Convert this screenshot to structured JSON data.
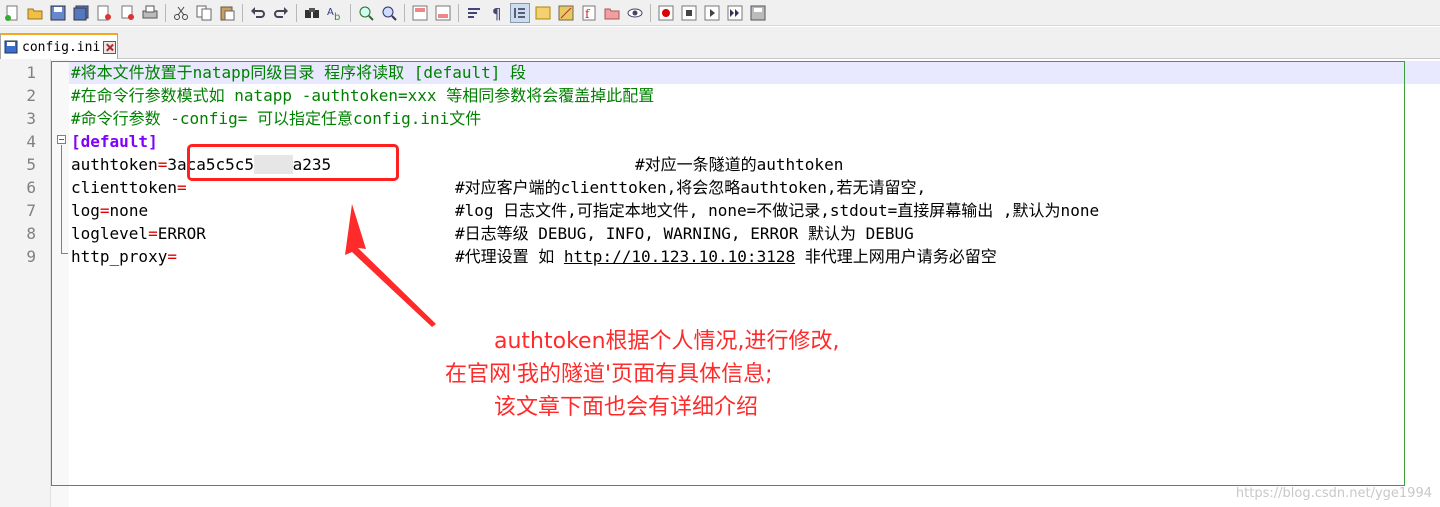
{
  "toolbar": {
    "icons": [
      "new-file-icon",
      "open-file-icon",
      "save-icon",
      "save-all-icon",
      "close-icon",
      "close-all-icon",
      "print-icon",
      "cut-icon",
      "copy-icon",
      "paste-icon",
      "undo-icon",
      "redo-icon",
      "find-icon",
      "replace-icon",
      "zoom-in-icon",
      "zoom-out-icon",
      "sync-vertical-icon",
      "sync-horizontal-icon",
      "word-wrap-icon",
      "show-all-chars-icon",
      "indent-guide-icon",
      "user-language-icon",
      "doc-map-icon",
      "function-list-icon",
      "folder-workspace-icon",
      "monitoring-icon",
      "macro-record-icon",
      "macro-stop-icon",
      "macro-play-icon",
      "macro-run-multiple-icon",
      "macro-save-icon"
    ]
  },
  "tab": {
    "label": "config.ini"
  },
  "editor": {
    "line_numbers": [
      "1",
      "2",
      "3",
      "4",
      "5",
      "6",
      "7",
      "8",
      "9"
    ],
    "lines": {
      "l1": "#将本文件放置于natapp同级目录 程序将读取 [default] 段",
      "l2": "#在命令行参数模式如 natapp -authtoken=xxx 等相同参数将会覆盖掉此配置",
      "l3": "#命令行参数 -config= 可以指定任意config.ini文件",
      "l4": "[default]",
      "l5_key": "authtoken",
      "l5_val_a": "3aca5c5c5",
      "l5_val_b": "a235",
      "l5_cmt": "#对应一条隧道的authtoken",
      "l6_key": "clienttoken",
      "l6_cmt": "#对应客户端的clienttoken,将会忽略authtoken,若无请留空,",
      "l7_key": "log",
      "l7_val": "none",
      "l7_cmt": "#log 日志文件,可指定本地文件, none=不做记录,stdout=直接屏幕输出 ,默认为none",
      "l8_key": "loglevel",
      "l8_val": "ERROR",
      "l8_cmt": "#日志等级 DEBUG, INFO, WARNING, ERROR 默认为 DEBUG",
      "l9_key": "http_proxy",
      "l9_cmt_a": "#代理设置 如 ",
      "l9_link": "http://10.123.10.10:3128",
      "l9_cmt_b": " 非代理上网用户请务必留空"
    },
    "equals": "="
  },
  "annotation": {
    "line1": "authtoken根据个人情况,进行修改,",
    "line2": "在官网'我的隧道'页面有具体信息;",
    "line3": "该文章下面也会有详细介绍",
    "color": "#ff2a2a"
  },
  "watermark": "https://blog.csdn.net/yge1994"
}
